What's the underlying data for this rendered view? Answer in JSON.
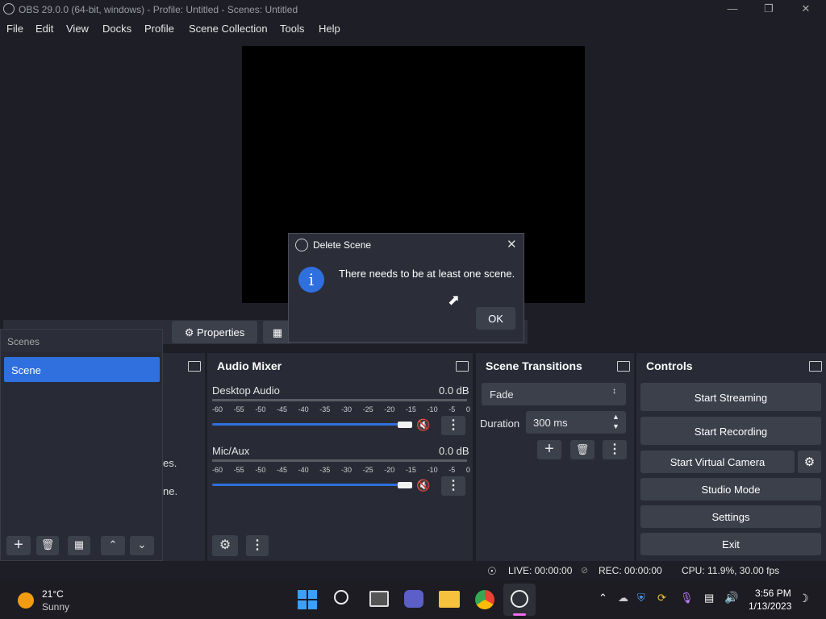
{
  "window": {
    "title": "OBS 29.0.0 (64-bit, windows) - Profile: Untitled - Scenes: Untitled"
  },
  "menu": [
    "File",
    "Edit",
    "View",
    "Docks",
    "Profile",
    "Scene Collection",
    "Tools",
    "Help"
  ],
  "dialog": {
    "title": "Delete Scene",
    "message": "There needs to be at least one scene.",
    "ok_label": "OK"
  },
  "sourcebar": {
    "properties_label": "Properties"
  },
  "scenes": {
    "header": "Scenes",
    "items": [
      "Scene"
    ]
  },
  "sources": {
    "hint1": "es.",
    "hint2": "ne."
  },
  "audio_mixer": {
    "title": "Audio Mixer",
    "channels": [
      {
        "name": "Desktop Audio",
        "db": "0.0 dB"
      },
      {
        "name": "Mic/Aux",
        "db": "0.0 dB"
      }
    ],
    "ticks": [
      "-60",
      "-55",
      "-50",
      "-45",
      "-40",
      "-35",
      "-30",
      "-25",
      "-20",
      "-15",
      "-10",
      "-5",
      "0"
    ]
  },
  "transitions": {
    "title": "Scene Transitions",
    "selected": "Fade",
    "duration_label": "Duration",
    "duration_value": "300 ms"
  },
  "controls": {
    "title": "Controls",
    "start_streaming": "Start Streaming",
    "start_recording": "Start Recording",
    "start_virtual_camera": "Start Virtual Camera",
    "studio_mode": "Studio Mode",
    "settings": "Settings",
    "exit": "Exit"
  },
  "status": {
    "live": "LIVE: 00:00:00",
    "rec": "REC: 00:00:00",
    "cpu": "CPU: 11.9%, 30.00 fps"
  },
  "taskbar": {
    "temp": "21°C",
    "weather": "Sunny",
    "time": "3:56 PM",
    "date": "1/13/2023"
  },
  "colors": {
    "accent": "#2f6fde",
    "mute": "#c0392b",
    "bg": "#1e1f26",
    "panel": "#282b35"
  }
}
